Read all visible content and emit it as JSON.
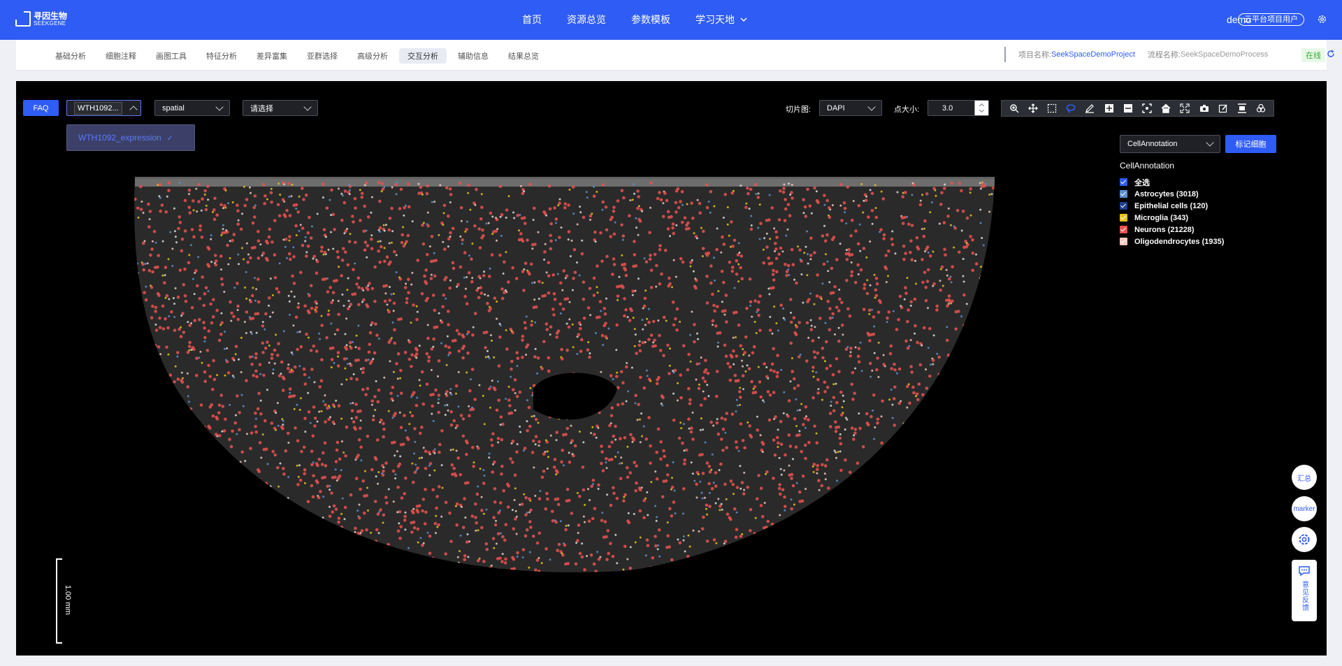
{
  "brand": {
    "name_cn": "寻因生物",
    "name_en": "SEEKGENE"
  },
  "nav": {
    "items": [
      {
        "label": "首页"
      },
      {
        "label": "资源总览"
      },
      {
        "label": "参数模板"
      },
      {
        "label": "学习天地"
      }
    ]
  },
  "user": {
    "name": "demo",
    "badge": "云平台项目用户"
  },
  "subnav": {
    "tabs": [
      {
        "label": "基础分析"
      },
      {
        "label": "细胞注释"
      },
      {
        "label": "画图工具"
      },
      {
        "label": "特征分析"
      },
      {
        "label": "差异富集"
      },
      {
        "label": "亚群选择"
      },
      {
        "label": "高级分析"
      },
      {
        "label": "交互分析"
      },
      {
        "label": "辅助信息"
      },
      {
        "label": "结果总览"
      }
    ],
    "active_tab": "交互分析",
    "project_label": "项目名称:",
    "project_name": "SeekSpaceDemoProject",
    "process_label": "流程名称:",
    "process_name": "SeekSpaceDemoProcess",
    "status": "在线"
  },
  "viewer": {
    "faq": "FAQ",
    "sample_select": "WTH1092...",
    "sample_option": "WTH1092_expression",
    "embedding_select": "spatial",
    "choose_select": "请选择",
    "slice_label": "切片图:",
    "slice_value": "DAPI",
    "point_size_label": "点大小:",
    "point_size": "3.0",
    "annotation_select": "CellAnnotation",
    "mark_button": "标记细胞",
    "legend_title": "CellAnnotation",
    "legend": [
      {
        "label": "全选",
        "color": "#2f5cf5"
      },
      {
        "label": "Astrocytes (3018)",
        "color": "#5b8fd0"
      },
      {
        "label": "Epithelial cells (120)",
        "color": "#1e3f8a"
      },
      {
        "label": "Microglia (343)",
        "color": "#e8c31a"
      },
      {
        "label": "Neurons (21228)",
        "color": "#e8524f"
      },
      {
        "label": "Oligodendrocytes (1935)",
        "color": "#f2c7bd"
      }
    ],
    "scale_label": "1.00 mm",
    "tools": [
      "zoom-in-icon",
      "move-icon",
      "box-select-icon",
      "lasso-icon",
      "draw-icon",
      "plus-icon",
      "minus-icon",
      "fit-icon",
      "home-icon",
      "fullscreen-icon",
      "camera-icon",
      "edit-icon",
      "export-icon",
      "color-icon"
    ]
  },
  "fabs": {
    "summary": "汇总",
    "marker": "marker",
    "feedback": "意见反馈"
  },
  "colors": {
    "brand": "#2f5cf5",
    "neuron": "#e8524f",
    "astro": "#5b8fd0",
    "micro": "#e8c31a",
    "oligo": "#f2c7bd"
  }
}
